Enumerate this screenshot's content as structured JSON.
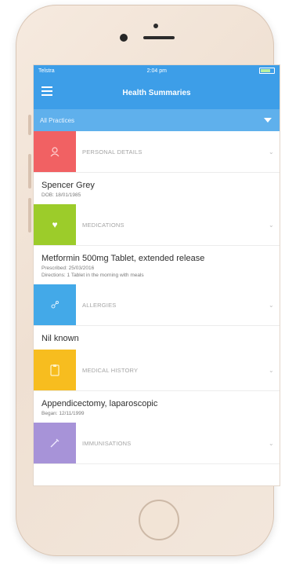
{
  "app": {
    "status": {
      "carrier": "Telstra",
      "time": "2:04 pm"
    },
    "nav_title": "Health Summaries",
    "filter": {
      "label": "All Practices"
    },
    "sections": [
      {
        "label": "PERSONAL DETAILS",
        "icon": "person-icon",
        "color": "#f16163",
        "main": "Spencer Grey",
        "sub": "DOB: 18/01/1985",
        "sub2": ""
      },
      {
        "label": "MEDICATIONS",
        "icon": "heart-icon",
        "color": "#9ccc2a",
        "main": "Metformin 500mg Tablet, extended release",
        "sub": "Prescribed: 25/03/2016",
        "sub2": "Directions: 1 Tablet in the morning with meals"
      },
      {
        "label": "ALLERGIES",
        "icon": "allergy-icon",
        "color": "#43a9e8",
        "main": "Nil known",
        "sub": "",
        "sub2": ""
      },
      {
        "label": "MEDICAL HISTORY",
        "icon": "clipboard-icon",
        "color": "#f7bd1f",
        "main": "Appendicectomy, laparoscopic",
        "sub": "Began: 12/11/1999",
        "sub2": ""
      },
      {
        "label": "IMMUNISATIONS",
        "icon": "syringe-icon",
        "color": "#a793d8",
        "main": "",
        "sub": "",
        "sub2": ""
      }
    ]
  }
}
